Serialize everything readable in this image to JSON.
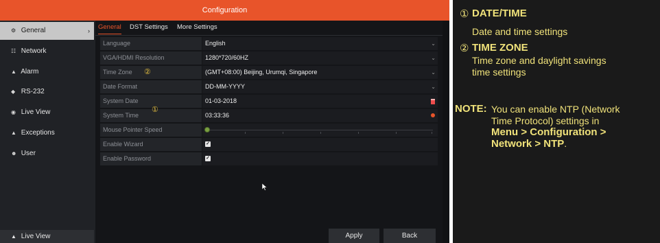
{
  "window": {
    "title": "Configuration"
  },
  "sidebar": {
    "items": [
      {
        "label": "General",
        "icon": "gear-icon",
        "active": true
      },
      {
        "label": "Network",
        "icon": "network-icon"
      },
      {
        "label": "Alarm",
        "icon": "alarm-icon"
      },
      {
        "label": "RS-232",
        "icon": "rs232-icon"
      },
      {
        "label": "Live View",
        "icon": "eye-icon"
      },
      {
        "label": "Exceptions",
        "icon": "warning-icon"
      },
      {
        "label": "User",
        "icon": "users-icon"
      }
    ],
    "bottom_label": "Live View",
    "bottom_icon": "home-icon"
  },
  "tabs": [
    "General",
    "DST Settings",
    "More Settings"
  ],
  "form": {
    "language": {
      "label": "Language",
      "value": "English"
    },
    "resolution": {
      "label": "VGA/HDMI Resolution",
      "value": "1280*720/60HZ"
    },
    "time_zone": {
      "label": "Time Zone",
      "value": "(GMT+08:00) Beijing, Urumqi, Singapore"
    },
    "date_format": {
      "label": "Date Format",
      "value": "DD-MM-YYYY"
    },
    "system_date": {
      "label": "System Date",
      "value": "01-03-2018"
    },
    "system_time": {
      "label": "System Time",
      "value": "03:33:36"
    },
    "mouse_speed": {
      "label": "Mouse Pointer Speed",
      "level": 0
    },
    "enable_wizard": {
      "label": "Enable Wizard",
      "checked": true
    },
    "enable_password": {
      "label": "Enable Password",
      "checked": true
    }
  },
  "markers": {
    "date_time": "①",
    "time_zone": "②"
  },
  "buttons": {
    "apply": "Apply",
    "back": "Back"
  },
  "notes": {
    "item1": {
      "marker": "①",
      "title": "DATE/TIME",
      "text": "Date and time settings"
    },
    "item2": {
      "marker": "②",
      "title": "TIME ZONE",
      "text_line1": "Time zone and daylight savings",
      "text_line2": "time settings"
    },
    "note": {
      "label": "NOTE:",
      "line1": "You can enable NTP (Network",
      "line2": "Time Protocol) settings in",
      "line3": "Menu > Configuration >",
      "line4_bold": "Network > NTP",
      "line4_tail": "."
    }
  },
  "colors": {
    "accent": "#e8542a",
    "note_text": "#f0e27a",
    "marker": "#e6c040"
  }
}
